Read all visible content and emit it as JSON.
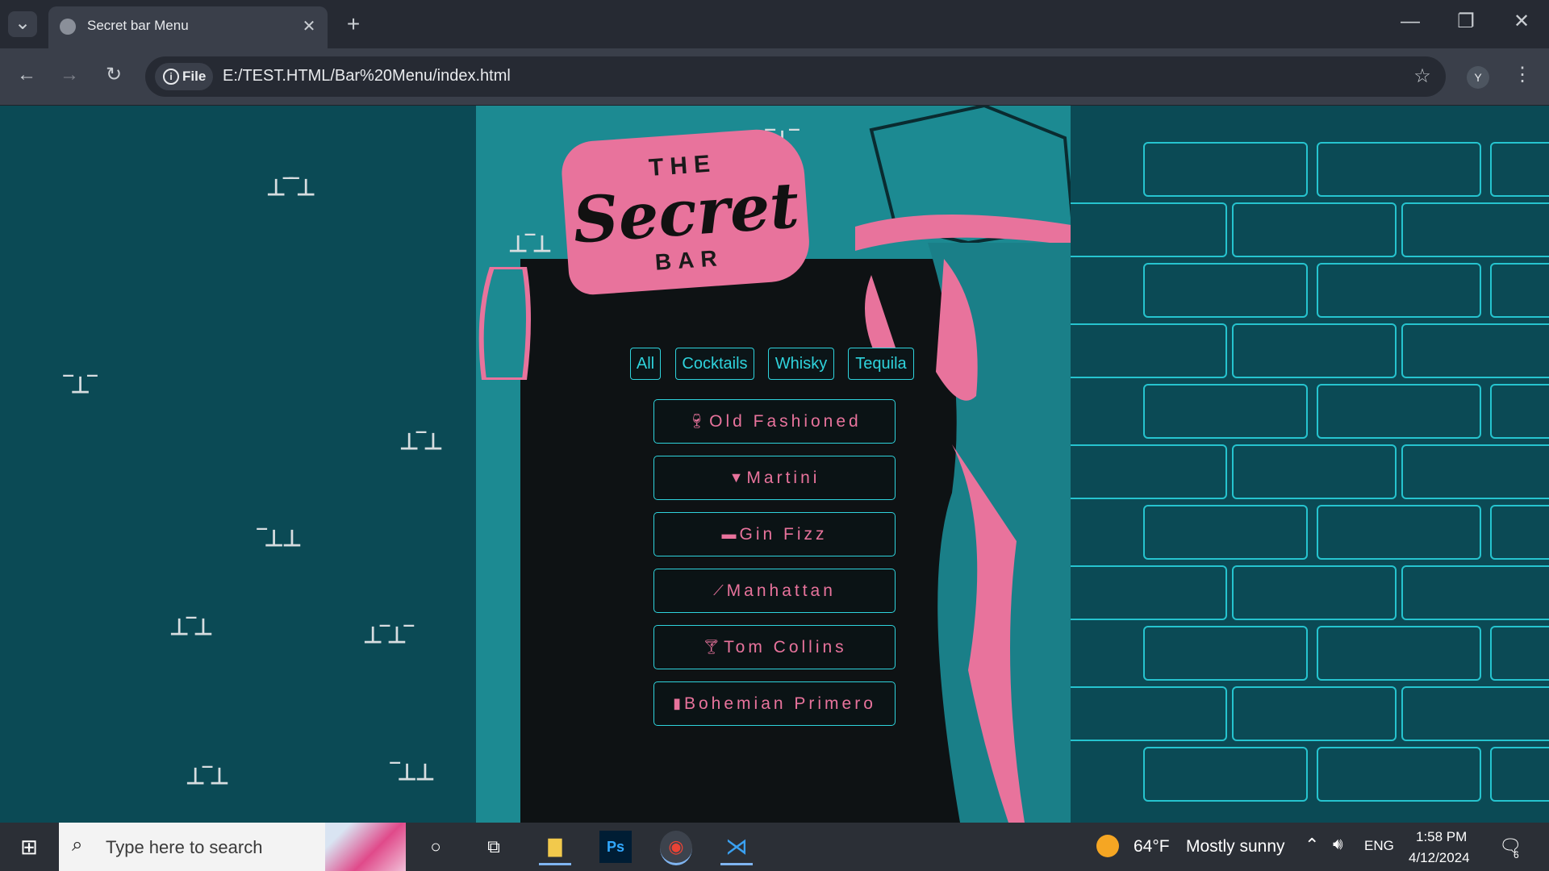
{
  "browser": {
    "tab_title": "Secret bar Menu",
    "file_chip": "File",
    "url": "E:/TEST.HTML/Bar%20Menu/index.html",
    "profile_initial": "Y"
  },
  "logo": {
    "line1": "THE",
    "line2": "Secret",
    "line3": "BAR"
  },
  "filters": [
    {
      "label": "All"
    },
    {
      "label": "Cocktails"
    },
    {
      "label": "Whisky"
    },
    {
      "label": "Tequila"
    }
  ],
  "menu_items": [
    {
      "label": "Old Fashioned",
      "icon": "wine-glass-icon"
    },
    {
      "label": "Martini",
      "icon": "martini-glass-icon"
    },
    {
      "label": "Gin Fizz",
      "icon": "tumbler-glass-icon"
    },
    {
      "label": "Manhattan",
      "icon": "bottle-icon"
    },
    {
      "label": "Tom Collins",
      "icon": "cocktail-citrus-icon"
    },
    {
      "label": "Bohemian Primero",
      "icon": "beer-mug-icon"
    }
  ],
  "taskbar": {
    "search_placeholder": "Type here to search",
    "weather_temp": "64°F",
    "weather_text": "Mostly sunny",
    "language": "ENG",
    "time": "1:58 PM",
    "date": "4/12/2024",
    "notification_count": "6"
  },
  "colors": {
    "accent_cyan": "#2fd3dc",
    "accent_pink": "#e8739c",
    "background_teal": "#0b4a55"
  }
}
